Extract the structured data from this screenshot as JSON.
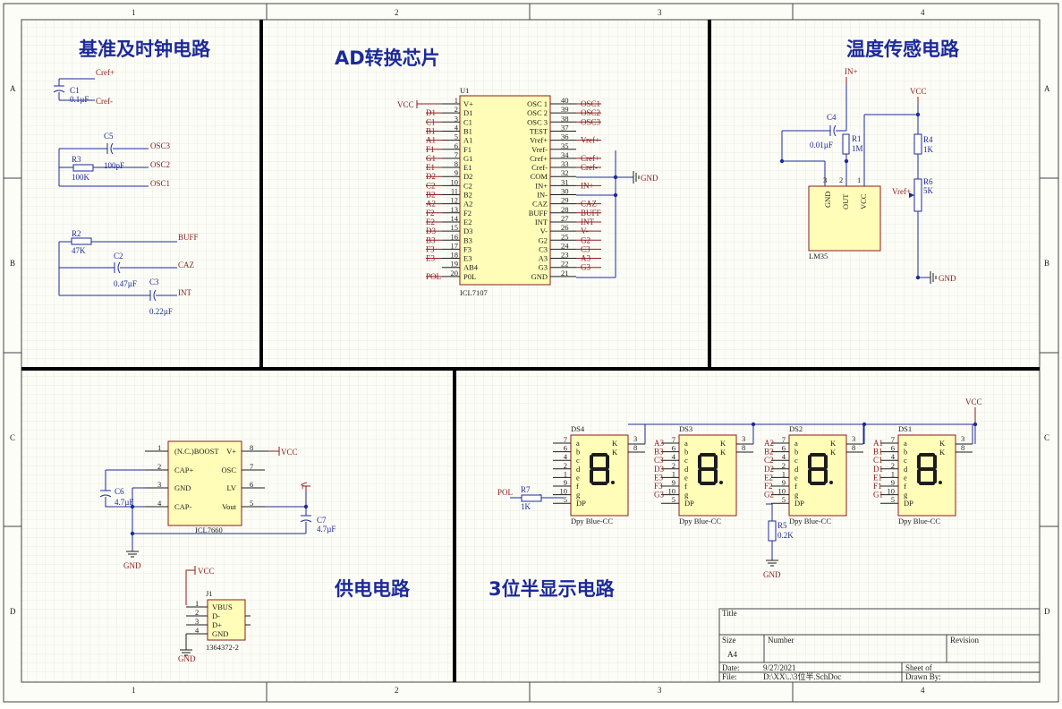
{
  "frame": {
    "cols": [
      "1",
      "2",
      "3",
      "4"
    ],
    "rows": [
      "A",
      "B",
      "C",
      "D"
    ]
  },
  "sections": {
    "ref_clock": "基准及时钟电路",
    "adc": "AD转换芯片",
    "temp": "温度传感电路",
    "power": "供电电路",
    "display": "3位半显示电路"
  },
  "ref_clock": {
    "c1": {
      "name": "C1",
      "value": "0.1µF"
    },
    "cref_pos": "Cref+",
    "cref_neg": "Cref-",
    "c5": {
      "name": "C5",
      "value": "100pF"
    },
    "r3": {
      "name": "R3",
      "value": "100K"
    },
    "osc3": "OSC3",
    "osc2": "OSC2",
    "osc1": "OSC1",
    "r2": {
      "name": "R2",
      "value": "47K"
    },
    "c2": {
      "name": "C2",
      "value": "0.47µF"
    },
    "c3": {
      "name": "C3",
      "value": "0.22µF"
    },
    "buff": "BUFF",
    "caz": "CAZ",
    "int": "INT"
  },
  "adc": {
    "designator": "U1",
    "part": "ICL7107",
    "vcc": "VCC",
    "gnd": "GND",
    "left_pins": [
      {
        "num": "1",
        "name": "V+",
        "net": "VCC"
      },
      {
        "num": "2",
        "name": "D1",
        "net": "D1"
      },
      {
        "num": "3",
        "name": "C1",
        "net": "C1"
      },
      {
        "num": "4",
        "name": "B1",
        "net": "B1"
      },
      {
        "num": "5",
        "name": "A1",
        "net": "A1"
      },
      {
        "num": "6",
        "name": "F1",
        "net": "F1"
      },
      {
        "num": "7",
        "name": "G1",
        "net": "G1"
      },
      {
        "num": "8",
        "name": "E1",
        "net": "E1"
      },
      {
        "num": "9",
        "name": "D2",
        "net": "D2"
      },
      {
        "num": "10",
        "name": "C2",
        "net": "C2"
      },
      {
        "num": "11",
        "name": "B2",
        "net": "B2"
      },
      {
        "num": "12",
        "name": "A2",
        "net": "A2"
      },
      {
        "num": "13",
        "name": "F2",
        "net": "F2"
      },
      {
        "num": "14",
        "name": "E2",
        "net": "E2"
      },
      {
        "num": "15",
        "name": "D3",
        "net": "D3"
      },
      {
        "num": "16",
        "name": "B3",
        "net": "B3"
      },
      {
        "num": "17",
        "name": "F3",
        "net": "F3"
      },
      {
        "num": "18",
        "name": "E3",
        "net": "E3"
      },
      {
        "num": "19",
        "name": "AB4",
        "net": ""
      },
      {
        "num": "20",
        "name": "P0L",
        "net": "POL"
      }
    ],
    "right_pins": [
      {
        "num": "40",
        "name": "OSC 1",
        "net": "OSC1"
      },
      {
        "num": "39",
        "name": "OSC 2",
        "net": "OSC2"
      },
      {
        "num": "38",
        "name": "OSC 3",
        "net": "OSC3"
      },
      {
        "num": "37",
        "name": "TEST",
        "net": ""
      },
      {
        "num": "36",
        "name": "Vref+",
        "net": "Vref+"
      },
      {
        "num": "35",
        "name": "Vref-",
        "net": ""
      },
      {
        "num": "34",
        "name": "Cref+",
        "net": "Cref+"
      },
      {
        "num": "33",
        "name": "Cref-",
        "net": "Cref-"
      },
      {
        "num": "32",
        "name": "COM",
        "net": ""
      },
      {
        "num": "31",
        "name": "IN+",
        "net": "IN+"
      },
      {
        "num": "30",
        "name": "IN-",
        "net": ""
      },
      {
        "num": "29",
        "name": "CAZ",
        "net": "CAZ"
      },
      {
        "num": "28",
        "name": "BUFF",
        "net": "BUFF"
      },
      {
        "num": "27",
        "name": "INT",
        "net": "INT"
      },
      {
        "num": "26",
        "name": "V-",
        "net": "V-"
      },
      {
        "num": "25",
        "name": "G2",
        "net": "G2"
      },
      {
        "num": "24",
        "name": "C3",
        "net": "C3"
      },
      {
        "num": "23",
        "name": "A3",
        "net": "A3"
      },
      {
        "num": "22",
        "name": "G3",
        "net": "G3"
      },
      {
        "num": "21",
        "name": "GND",
        "net": ""
      }
    ]
  },
  "temp": {
    "in_pos": "IN+",
    "vcc": "VCC",
    "gnd": "GND",
    "vref": "Vref+",
    "c4": {
      "name": "C4",
      "value": "0.01µF"
    },
    "r1": {
      "name": "R1",
      "value": "1M"
    },
    "r4": {
      "name": "R4",
      "value": "1K"
    },
    "r6": {
      "name": "R6",
      "value": "5K"
    },
    "lm35": {
      "name": "LM35",
      "pins": [
        "GND",
        "OUT",
        "VCC"
      ],
      "nums": [
        "3",
        "2",
        "1"
      ]
    }
  },
  "power": {
    "u": {
      "part": "ICL7660",
      "left": [
        {
          "num": "1",
          "name": "(N.C.)BOOST"
        },
        {
          "num": "2",
          "name": "CAP+"
        },
        {
          "num": "3",
          "name": "GND"
        },
        {
          "num": "4",
          "name": "CAP-"
        }
      ],
      "right": [
        {
          "num": "8",
          "name": "V+"
        },
        {
          "num": "7",
          "name": "OSC"
        },
        {
          "num": "6",
          "name": "LV"
        },
        {
          "num": "5",
          "name": "Vout"
        }
      ]
    },
    "vcc": "VCC",
    "gnd": "GND",
    "vminus": "V-",
    "c6": {
      "name": "C6",
      "value": "4.7µF"
    },
    "c7": {
      "name": "C7",
      "value": "4.7µF"
    },
    "j1": {
      "name": "J1",
      "part": "1364372-2",
      "pins": [
        {
          "num": "1",
          "name": "VBUS"
        },
        {
          "num": "2",
          "name": "D-"
        },
        {
          "num": "3",
          "name": "D+"
        },
        {
          "num": "4",
          "name": "GND"
        }
      ]
    }
  },
  "display": {
    "vcc": "VCC",
    "gnd": "GND",
    "pol": "POL",
    "r7": {
      "name": "R7",
      "value": "1K"
    },
    "r5": {
      "name": "R5",
      "value": "0.2K"
    },
    "part": "Dpy Blue-CC",
    "segs": [
      "a",
      "b",
      "c",
      "d",
      "e",
      "f",
      "g",
      "DP"
    ],
    "kk": [
      "K",
      "K"
    ],
    "kk_nums": [
      "3",
      "8"
    ],
    "digit": "8",
    "digits": [
      {
        "name": "DS4",
        "pins": [
          "7",
          "6",
          "4",
          "2",
          "1",
          "9",
          "10",
          "5"
        ],
        "nets": [
          "",
          "",
          "",
          "",
          "",
          "",
          "",
          ""
        ]
      },
      {
        "name": "DS3",
        "pins": [
          "7",
          "6",
          "4",
          "2",
          "1",
          "9",
          "10",
          "5"
        ],
        "nets": [
          "A3",
          "B3",
          "C3",
          "D3",
          "E3",
          "F3",
          "G3",
          ""
        ]
      },
      {
        "name": "DS2",
        "pins": [
          "7",
          "6",
          "4",
          "2",
          "1",
          "9",
          "10",
          "5"
        ],
        "nets": [
          "A2",
          "B2",
          "C2",
          "D2",
          "E2",
          "F2",
          "G2",
          ""
        ]
      },
      {
        "name": "DS1",
        "pins": [
          "7",
          "6",
          "4",
          "2",
          "1",
          "9",
          "10",
          "5"
        ],
        "nets": [
          "A1",
          "B1",
          "C1",
          "D1",
          "E1",
          "F1",
          "G1",
          ""
        ]
      }
    ]
  },
  "title_block": {
    "title": "Title",
    "size_label": "Size",
    "size": "A4",
    "number_label": "Number",
    "revision_label": "Revision",
    "date_label": "Date:",
    "date": "9/27/2021",
    "sheet": "Sheet  of",
    "file_label": "File:",
    "file": "D:\\XX\\..\\3位半.SchDoc",
    "drawn": "Drawn By:"
  }
}
